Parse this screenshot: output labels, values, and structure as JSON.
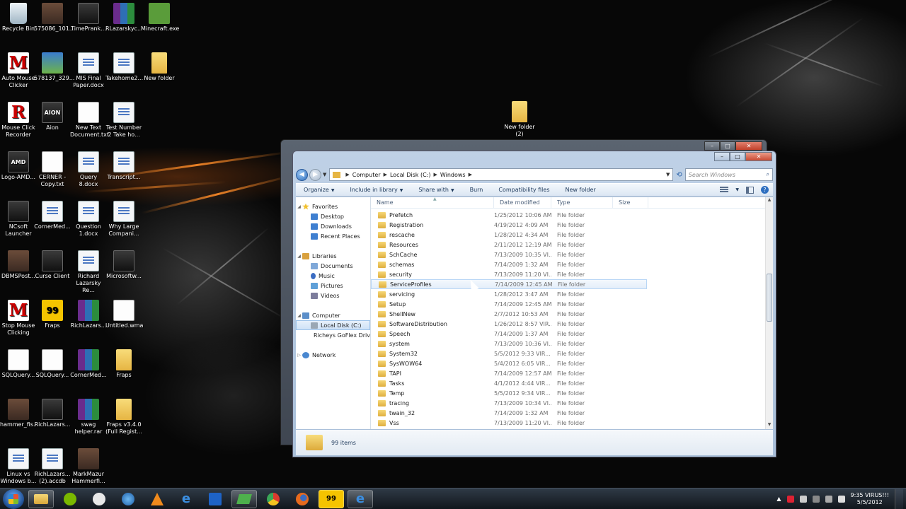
{
  "desktop": {
    "icons": [
      {
        "label": "Recycle Bin",
        "kind": "bin"
      },
      {
        "label": "575086_101...",
        "kind": "img"
      },
      {
        "label": "TimePrank...",
        "kind": "app"
      },
      {
        "label": "RLazarskyc...",
        "kind": "rar"
      },
      {
        "label": "Minecraft.exe",
        "kind": "green"
      },
      {
        "label": "Auto Mouse Clicker",
        "kind": "red",
        "glyph": "M"
      },
      {
        "label": "578137_329...",
        "kind": "sky"
      },
      {
        "label": "MIS Final Paper.docx",
        "kind": "doc"
      },
      {
        "label": "Takehome2...",
        "kind": "doc"
      },
      {
        "label": "New folder",
        "kind": "folder"
      },
      {
        "label": "Mouse Click Recorder",
        "kind": "red",
        "glyph": "R"
      },
      {
        "label": "Aion",
        "kind": "app",
        "glyph": "AION"
      },
      {
        "label": "New Text Document.txt",
        "kind": "txt"
      },
      {
        "label": "Test Number 2 Take ho...",
        "kind": "doc"
      },
      {
        "label": "Logo-AMD...",
        "kind": "app",
        "glyph": "AMD"
      },
      {
        "label": "CERNER - Copy.txt",
        "kind": "txt"
      },
      {
        "label": "Query 8.docx",
        "kind": "doc"
      },
      {
        "label": "Transcript...",
        "kind": "doc"
      },
      {
        "label": "NCsoft Launcher",
        "kind": "app"
      },
      {
        "label": "CornerMed...",
        "kind": "doc"
      },
      {
        "label": "Question 1.docx",
        "kind": "doc"
      },
      {
        "label": "Why Large Compani...",
        "kind": "doc"
      },
      {
        "label": "DBMSPost...",
        "kind": "img"
      },
      {
        "label": "Curse Client",
        "kind": "app"
      },
      {
        "label": "Richard Lazarsky Re...",
        "kind": "doc"
      },
      {
        "label": "Microsoftw...",
        "kind": "app"
      },
      {
        "label": "Stop Mouse Clicking",
        "kind": "red",
        "glyph": "M"
      },
      {
        "label": "Fraps",
        "kind": "fraps",
        "glyph": "99"
      },
      {
        "label": "RichLazars...",
        "kind": "rar"
      },
      {
        "label": "Untitled.wma",
        "kind": "txt"
      },
      {
        "label": "SQLQuery...",
        "kind": "txt"
      },
      {
        "label": "SQLQuery...",
        "kind": "txt"
      },
      {
        "label": "CornerMed...",
        "kind": "rar"
      },
      {
        "label": "Fraps",
        "kind": "folder"
      },
      {
        "label": "hammer_fis...",
        "kind": "img"
      },
      {
        "label": "RichLazars...",
        "kind": "app"
      },
      {
        "label": "swag helper.rar",
        "kind": "rar"
      },
      {
        "label": "Fraps v3.4.0 (Full Regist...",
        "kind": "folder"
      },
      {
        "label": "Linux vs Windows b...",
        "kind": "doc"
      },
      {
        "label": "RichLazars... (2).accdb",
        "kind": "doc"
      },
      {
        "label": "MarkMazur Hammerfi...",
        "kind": "img"
      },
      {
        "label": "New folder (2)",
        "kind": "folder"
      }
    ]
  },
  "explorer": {
    "address": {
      "crumbs": [
        "Computer",
        "Local Disk (C:)",
        "Windows"
      ]
    },
    "search_placeholder": "Search Windows",
    "toolbar": {
      "organize": "Organize",
      "include_in_library": "Include in library",
      "share_with": "Share with",
      "burn": "Burn",
      "compatibility_files": "Compatibility files",
      "new_folder": "New folder"
    },
    "nav": {
      "favorites": "Favorites",
      "desktop": "Desktop",
      "downloads": "Downloads",
      "recent_places": "Recent Places",
      "libraries": "Libraries",
      "documents": "Documents",
      "music": "Music",
      "pictures": "Pictures",
      "videos": "Videos",
      "computer": "Computer",
      "local_disk": "Local Disk (C:)",
      "ext_drive": "Richeys GoFlex Drive",
      "network": "Network"
    },
    "columns": {
      "name": "Name",
      "date": "Date modified",
      "type": "Type",
      "size": "Size"
    },
    "rows": [
      {
        "name": "Prefetch",
        "date": "1/25/2012 10:06 AM",
        "type": "File folder"
      },
      {
        "name": "Registration",
        "date": "4/19/2012 4:09 AM",
        "type": "File folder"
      },
      {
        "name": "rescache",
        "date": "1/28/2012 4:34 AM",
        "type": "File folder"
      },
      {
        "name": "Resources",
        "date": "2/11/2012 12:19 AM",
        "type": "File folder"
      },
      {
        "name": "SchCache",
        "date": "7/13/2009 10:35 VI...",
        "type": "File folder"
      },
      {
        "name": "schemas",
        "date": "7/14/2009 1:32 AM",
        "type": "File folder"
      },
      {
        "name": "security",
        "date": "7/13/2009 11:20 VI...",
        "type": "File folder"
      },
      {
        "name": "ServiceProfiles",
        "date": "7/14/2009 12:45 AM",
        "type": "File folder"
      },
      {
        "name": "servicing",
        "date": "1/28/2012 3:47 AM",
        "type": "File folder"
      },
      {
        "name": "Setup",
        "date": "7/14/2009 12:45 AM",
        "type": "File folder"
      },
      {
        "name": "ShellNew",
        "date": "2/7/2012 10:53 AM",
        "type": "File folder"
      },
      {
        "name": "SoftwareDistribution",
        "date": "1/26/2012 8:57 VIR...",
        "type": "File folder"
      },
      {
        "name": "Speech",
        "date": "7/14/2009 1:37 AM",
        "type": "File folder"
      },
      {
        "name": "system",
        "date": "7/13/2009 10:36 VI...",
        "type": "File folder"
      },
      {
        "name": "System32",
        "date": "5/5/2012 9:33 VIR...",
        "type": "File folder"
      },
      {
        "name": "SysWOW64",
        "date": "5/4/2012 6:05 VIR...",
        "type": "File folder"
      },
      {
        "name": "TAPI",
        "date": "7/14/2009 12:57 AM",
        "type": "File folder"
      },
      {
        "name": "Tasks",
        "date": "4/1/2012 4:44 VIR...",
        "type": "File folder"
      },
      {
        "name": "Temp",
        "date": "5/5/2012 9:34 VIR...",
        "type": "File folder"
      },
      {
        "name": "tracing",
        "date": "7/13/2009 10:34 VI...",
        "type": "File folder"
      },
      {
        "name": "twain_32",
        "date": "7/14/2009 1:32 AM",
        "type": "File folder"
      },
      {
        "name": "Vss",
        "date": "7/13/2009 11:20 VI...",
        "type": "File folder"
      }
    ],
    "hover_row_index": 7,
    "status": "99 items"
  },
  "taskbar": {
    "clock_time": "9:35 VIRUS!!!",
    "clock_date": "5/5/2012"
  }
}
